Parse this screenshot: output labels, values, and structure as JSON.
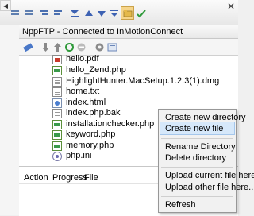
{
  "panel": {
    "title": "NppFTP - Connected to InMotionConnect"
  },
  "files": [
    {
      "name": "hello.pdf",
      "icon": "pdf-file-icon"
    },
    {
      "name": "hello_Zend.php",
      "icon": "php-file-icon"
    },
    {
      "name": "HighlightHunter.MacSetup.1.2.3(1).dmg",
      "icon": "document-file-icon"
    },
    {
      "name": "home.txt",
      "icon": "document-file-icon"
    },
    {
      "name": "index.html",
      "icon": "html-file-icon"
    },
    {
      "name": "index.php.bak",
      "icon": "document-file-icon"
    },
    {
      "name": "installationchecker.php",
      "icon": "php-file-icon"
    },
    {
      "name": "keyword.php",
      "icon": "php-file-icon"
    },
    {
      "name": "memory.php",
      "icon": "php-file-icon"
    },
    {
      "name": "php.ini",
      "icon": "ini-file-icon"
    }
  ],
  "queue": {
    "columns": [
      "Action",
      "Progress",
      "File"
    ]
  },
  "context_menu": {
    "items": [
      "Create new directory",
      "Create new file",
      "Rename Directory",
      "Delete directory",
      "Upload current file here",
      "Upload other file here...",
      "Refresh"
    ],
    "highlighted_index": 1
  },
  "colors": {
    "menu_highlight": "#d6e8fa",
    "toolbar_active": "#f6d58a"
  }
}
